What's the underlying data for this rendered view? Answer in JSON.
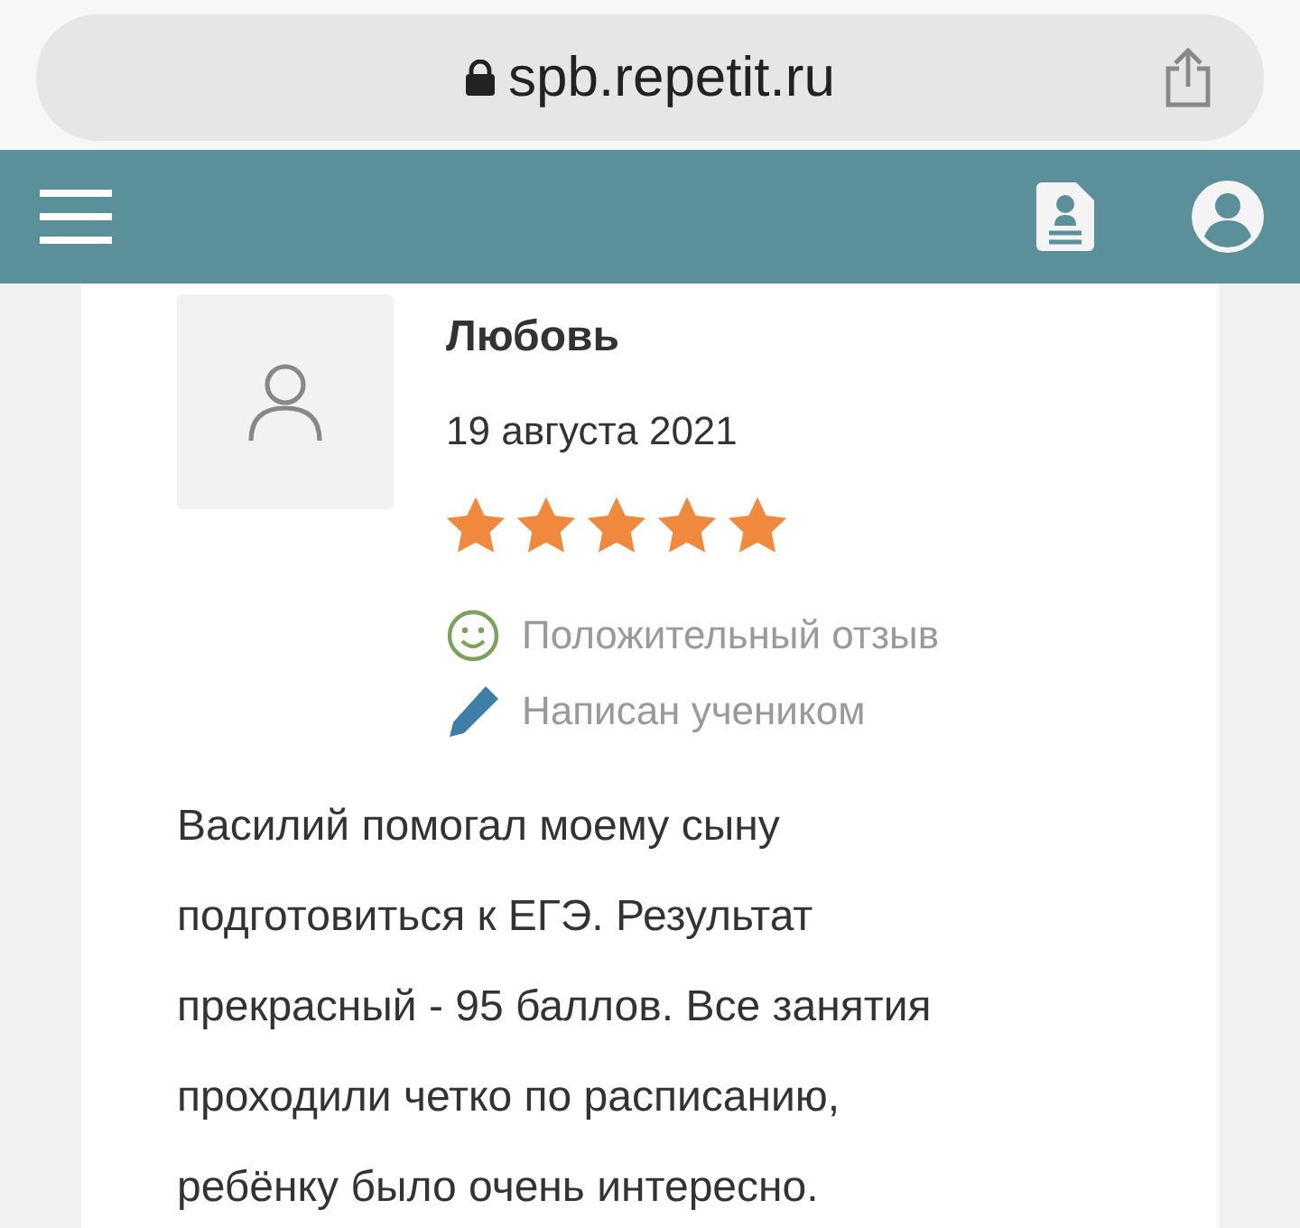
{
  "browser": {
    "url": "spb.repetit.ru"
  },
  "review": {
    "author": "Любовь",
    "date": "19 августа 2021",
    "stars": 5,
    "tags": [
      {
        "kind": "positive",
        "label": "Положительный отзыв"
      },
      {
        "kind": "author",
        "label": "Написан учеником"
      }
    ],
    "text": "Василий помогал моему сыну подготовиться к ЕГЭ. Результат прекрасный - 95 баллов. Все занятия проходили четко по расписанию, ребёнку было очень интересно."
  }
}
